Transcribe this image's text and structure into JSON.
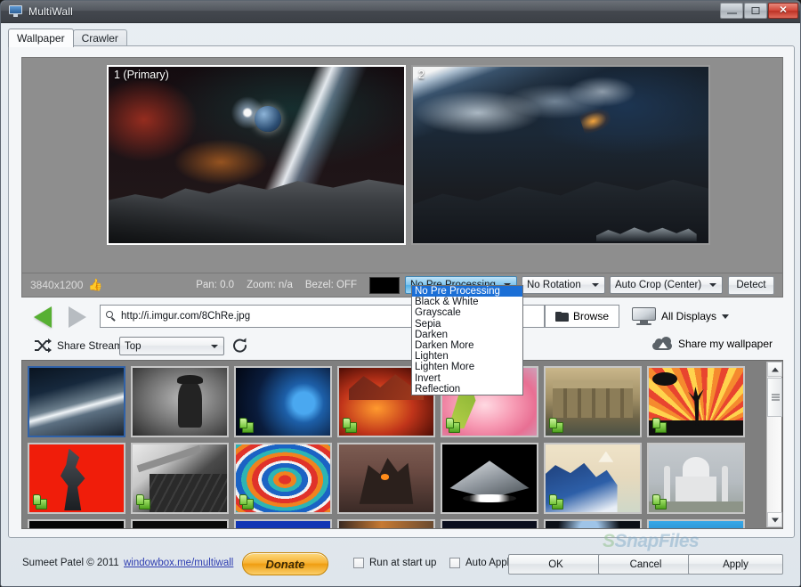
{
  "window": {
    "title": "MultiWall",
    "icon": "monitor-icon",
    "controls": {
      "minimize": "–",
      "restore": "❐",
      "close": "✕"
    }
  },
  "tabs": [
    {
      "label": "Wallpaper",
      "active": true
    },
    {
      "label": "Crawler",
      "active": false
    }
  ],
  "preview": {
    "monitors": [
      {
        "label": "1 (Primary)",
        "primary": true
      },
      {
        "label": "2",
        "primary": false
      }
    ]
  },
  "status": {
    "resolution": "3840x1200",
    "like_icon": "thumbs-up-icon",
    "pan": "Pan: 0.0",
    "zoom": "Zoom: n/a",
    "bezel": "Bezel: OFF",
    "background_color": "#000000"
  },
  "preprocess": {
    "selected": "No Pre Processing",
    "open": true,
    "options": [
      "No Pre Processing",
      "Black & White",
      "Grayscale",
      "Sepia",
      "Darken",
      "Darken More",
      "Lighten",
      "Lighten More",
      "Invert",
      "Reflection"
    ]
  },
  "rotation": {
    "selected": "No Rotation"
  },
  "crop": {
    "selected": "Auto Crop (Center)"
  },
  "detect_button": "Detect",
  "urlbar": {
    "value": "http://i.imgur.com/8ChRe.jpg",
    "search_icon": "magnifier-icon",
    "prev_icon": "previous-arrow-icon",
    "next_icon": "next-arrow-icon",
    "browse_label": "Browse",
    "browse_icon": "folder-icon",
    "display_label": "All Displays",
    "display_icon": "monitor-icon"
  },
  "share": {
    "shuffle_icon": "shuffle-icon",
    "label": "Share Stream",
    "stream_selected": "Top",
    "refresh_icon": "refresh-icon",
    "share_wallpaper_label": "Share my wallpaper",
    "cloud_icon": "cloud-upload-icon"
  },
  "thumbnails": {
    "scrollbar": {
      "up_icon": "scroll-up-icon",
      "down_icon": "scroll-down-icon"
    },
    "items": [
      {
        "name": "earth-from-orbit",
        "liked": false,
        "selected": true
      },
      {
        "name": "rorschach-noir",
        "liked": false,
        "selected": false
      },
      {
        "name": "blue-planet",
        "liked": true,
        "selected": false
      },
      {
        "name": "fire-dragon",
        "liked": true,
        "selected": false
      },
      {
        "name": "pink-lily-flower",
        "liked": true,
        "selected": false
      },
      {
        "name": "ancient-ruins",
        "liked": true,
        "selected": false
      },
      {
        "name": "african-sunset-safari",
        "liked": true,
        "selected": false
      },
      {
        "name": "red-dark-knight",
        "liked": true,
        "selected": false
      },
      {
        "name": "vintage-typewriter",
        "liked": true,
        "selected": false
      },
      {
        "name": "colorful-swirl",
        "liked": true,
        "selected": false
      },
      {
        "name": "rusty-machine",
        "liked": false,
        "selected": false
      },
      {
        "name": "star-destroyer",
        "liked": false,
        "selected": false
      },
      {
        "name": "great-wave-kanagawa",
        "liked": true,
        "selected": false
      },
      {
        "name": "taj-mahal",
        "liked": true,
        "selected": false
      }
    ]
  },
  "footer": {
    "copyright": "Sumeet Patel © 2011",
    "link": "windowbox.me/multiwall",
    "donate": "Donate",
    "run_at_startup": {
      "label": "Run at start up",
      "checked": false
    },
    "auto_apply": {
      "label": "Auto Apply",
      "checked": false
    },
    "ok": "OK",
    "cancel": "Cancel",
    "apply": "Apply"
  },
  "watermark": {
    "prefix": "S",
    "text": "SnapFiles"
  }
}
